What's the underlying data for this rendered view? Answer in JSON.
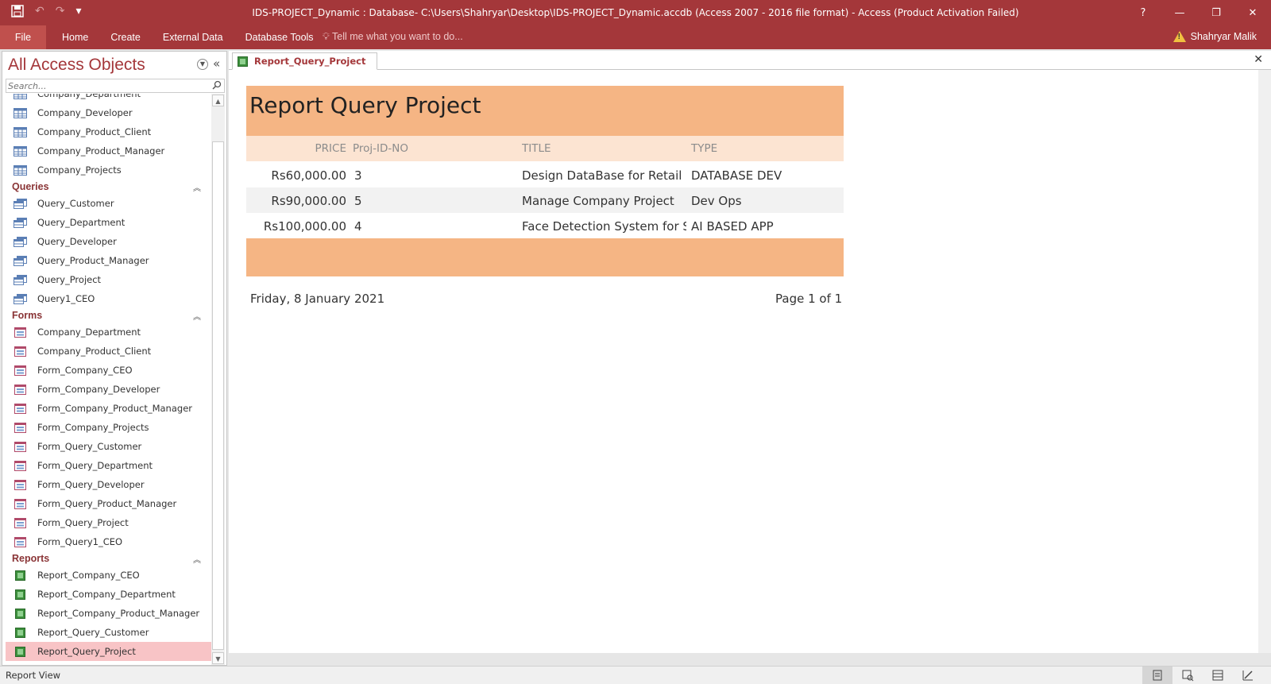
{
  "window": {
    "title": "IDS-PROJECT_Dynamic : Database- C:\\Users\\Shahryar\\Desktop\\IDS-PROJECT_Dynamic.accdb (Access 2007 - 2016 file format) - Access (Product Activation Failed)",
    "help": "?",
    "minimize": "—",
    "restore": "❐",
    "close": "✕",
    "accent_color": "#a4373a"
  },
  "qat": {
    "save_icon": "save-icon",
    "undo": "↶",
    "redo": "↷",
    "customize": "▾"
  },
  "ribbon": {
    "tabs": [
      "File",
      "Home",
      "Create",
      "External Data",
      "Database Tools"
    ],
    "tell_me": "Tell me what you want to do...",
    "user": "Shahryar Malik"
  },
  "navpane": {
    "title": "All Access Objects",
    "search_placeholder": "Search...",
    "items": [
      {
        "type": "table",
        "label": "Company_Department"
      },
      {
        "type": "table",
        "label": "Company_Developer"
      },
      {
        "type": "table",
        "label": "Company_Product_Client"
      },
      {
        "type": "table",
        "label": "Company_Product_Manager"
      },
      {
        "type": "table",
        "label": "Company_Projects"
      },
      {
        "type": "group",
        "label": "Queries"
      },
      {
        "type": "query",
        "label": "Query_Customer"
      },
      {
        "type": "query",
        "label": "Query_Department"
      },
      {
        "type": "query",
        "label": "Query_Developer"
      },
      {
        "type": "query",
        "label": "Query_Product_Manager"
      },
      {
        "type": "query",
        "label": "Query_Project"
      },
      {
        "type": "query",
        "label": "Query1_CEO"
      },
      {
        "type": "group",
        "label": "Forms"
      },
      {
        "type": "form",
        "label": "Company_Department"
      },
      {
        "type": "form",
        "label": "Company_Product_Client"
      },
      {
        "type": "form",
        "label": "Form_Company_CEO"
      },
      {
        "type": "form",
        "label": "Form_Company_Developer"
      },
      {
        "type": "form",
        "label": "Form_Company_Product_Manager"
      },
      {
        "type": "form",
        "label": "Form_Company_Projects"
      },
      {
        "type": "form",
        "label": "Form_Query_Customer"
      },
      {
        "type": "form",
        "label": "Form_Query_Department"
      },
      {
        "type": "form",
        "label": "Form_Query_Developer"
      },
      {
        "type": "form",
        "label": "Form_Query_Product_Manager"
      },
      {
        "type": "form",
        "label": "Form_Query_Project"
      },
      {
        "type": "form",
        "label": "Form_Query1_CEO"
      },
      {
        "type": "group",
        "label": "Reports"
      },
      {
        "type": "report",
        "label": "Report_Company_CEO"
      },
      {
        "type": "report",
        "label": "Report_Company_Department"
      },
      {
        "type": "report",
        "label": "Report_Company_Product_Manager"
      },
      {
        "type": "report",
        "label": "Report_Query_Customer"
      },
      {
        "type": "report",
        "label": "Report_Query_Project",
        "selected": true
      }
    ]
  },
  "document": {
    "tab_label": "Report_Query_Project",
    "close": "✕"
  },
  "report": {
    "title": "Report Query Project",
    "columns": {
      "price": "PRICE",
      "id": "Proj-ID-NO",
      "title": "TITLE",
      "type": "TYPE"
    },
    "rows": [
      {
        "price": "Rs60,000.00",
        "id": "3",
        "title": "Design DataBase for Retail Se",
        "type": "DATABASE DEV"
      },
      {
        "price": "Rs90,000.00",
        "id": "5",
        "title": "Manage Company Project",
        "type": "Dev Ops"
      },
      {
        "price": "Rs100,000.00",
        "id": "4",
        "title": "Face Detection System for Se",
        "type": "AI BASED APP"
      }
    ],
    "date": "Friday, 8 January 2021",
    "page": "Page 1 of 1",
    "header_color": "#f5b584",
    "colheader_color": "#fce4d2"
  },
  "statusbar": {
    "text": "Report View",
    "views": [
      "report-view-icon",
      "print-preview-icon",
      "layout-view-icon",
      "design-view-icon"
    ]
  }
}
